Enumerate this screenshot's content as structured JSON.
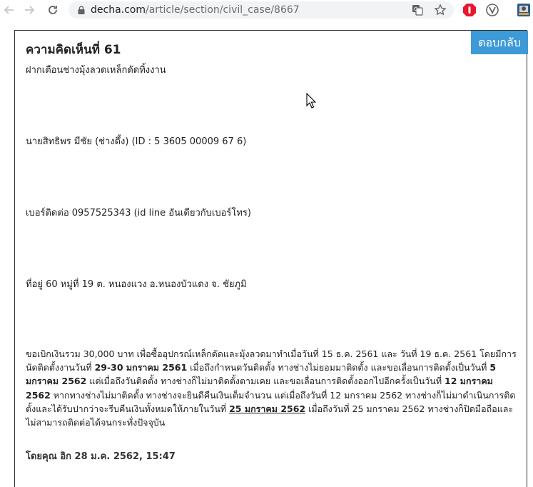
{
  "browser": {
    "url_domain": "decha.com",
    "url_path": "/article/section/civil_case/8667"
  },
  "post": {
    "reply_label": "ตอบกลับ",
    "title": "ความคิดเห็นที่ 61",
    "subtitle": "ฝากเตือนช่างมุ้งลวดเหล็กดัดทิ้งงาน",
    "name_line": "นายสิทธิพร มีชัย (ช่างดึ้ง) (ID : 5 3605 00009 67 6)",
    "phone_line": "เบอร์ติดต่อ 0957525343 (id line อันเดียวกับเบอร์โทร)",
    "address_line": "ที่อยู่ 60 หมู่ที่ 19 ต. หนองแวง อ.หนองบัวแดง จ. ชัยภูมิ",
    "body": {
      "p1": "ขอเบิกเงินรวม 30,000 บาท เพื่อซื้ออุปกรณ์เหล็กดัดและมุ้งลวดมาทำเมื่อวันที่ 15 ธ.ค. 2561 และ วันที่ 19 ธ.ค. 2561  โดยมีการนัดติดตั้งงานวันที่ ",
      "b1": "29-30 มกราคม 2561",
      "p2": " เมื่อถึงกำหนดวันติดตั้ง  ทางช่างไม่ยอมมาติดตั้ง และขอเลื่อนการติดตั้งเป็นวันที่ ",
      "b2": "5 มกราคม 2562",
      "p3": " แต่เมื่อถึงวันติดตั้ง ทางช่างก็ไม่มาติดตั้งตามเคย  และขอเลื่อนการติดตั้งออกไปอีกครั้งเป็นวันที่ ",
      "b3": "12 มกราคม 2562",
      "p4": " หากทางช่างไม่มาติดตั้ง  ทางช่างจะยินดีคืนเงินเต็มจำนวน แต่เมื่อถึงวันที่ 12 มกราคม 2562 ทางช่างก็ไม่มาดำเนินการติดตั้งและได้รับปากว่าจะรีบคืนเงินทั้งหมดให้ภายในวันที่ ",
      "u1": "25 มกราคม 2562",
      "p5": "  เมื่อถึงวันที่ 25 มกราคม 2562 ทางช่างก็ปิดมือถือและไม่สามารถติดต่อได้จนกระทั่งปัจจุบัน"
    },
    "byline": "โดยคุณ อิก 28 ม.ค. 2562, 15:47"
  }
}
